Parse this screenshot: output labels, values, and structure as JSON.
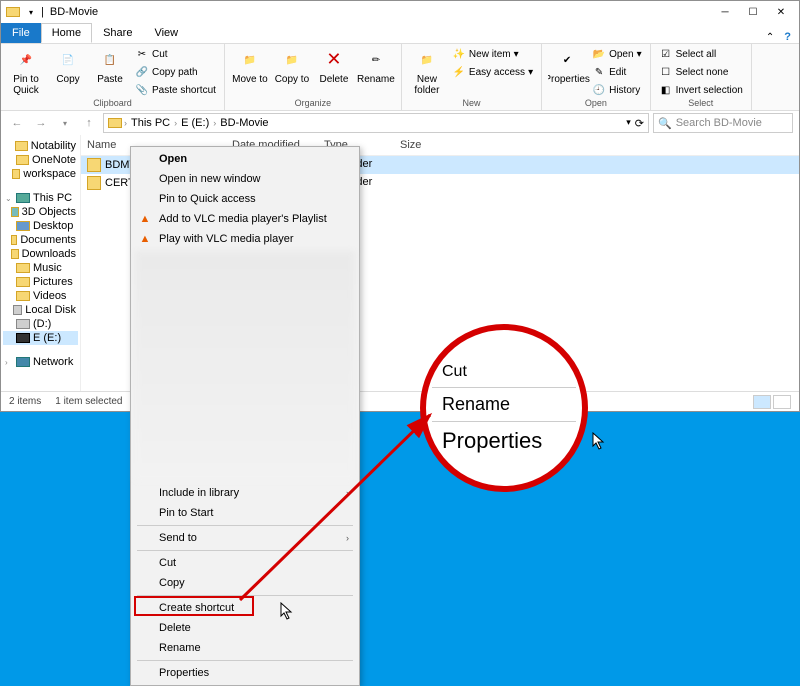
{
  "titlebar": {
    "title": "BD-Movie"
  },
  "tabs": {
    "file": "File",
    "home": "Home",
    "share": "Share",
    "view": "View"
  },
  "ribbon": {
    "clipboard": {
      "pin": "Pin to Quick access",
      "copy": "Copy",
      "paste": "Paste",
      "cut": "Cut",
      "copy_path": "Copy path",
      "paste_shortcut": "Paste shortcut",
      "label": "Clipboard"
    },
    "organize": {
      "move_to": "Move to",
      "copy_to": "Copy to",
      "delete": "Delete",
      "rename": "Rename",
      "label": "Organize"
    },
    "new": {
      "new_folder": "New folder",
      "new_item": "New item",
      "easy_access": "Easy access",
      "label": "New"
    },
    "open": {
      "properties": "Properties",
      "open": "Open",
      "edit": "Edit",
      "history": "History",
      "label": "Open"
    },
    "select": {
      "select_all": "Select all",
      "select_none": "Select none",
      "invert": "Invert selection",
      "label": "Select"
    }
  },
  "breadcrumbs": {
    "root": "This PC",
    "drive": "E (E:)",
    "folder": "BD-Movie"
  },
  "search": {
    "placeholder": "Search BD-Movie"
  },
  "nav": {
    "quick": [
      "Notability",
      "OneNote",
      "workspace"
    ],
    "this_pc": "This PC",
    "pc_items": [
      "3D Objects",
      "Desktop",
      "Documents",
      "Downloads",
      "Music",
      "Pictures",
      "Videos"
    ],
    "drives": [
      "Local Disk",
      "(D:)",
      "E (E:)"
    ],
    "network": "Network"
  },
  "columns": {
    "name": "Name",
    "date": "Date modified",
    "type": "Type",
    "size": "Size"
  },
  "rows": [
    {
      "name": "BDMV",
      "type": "File folder"
    },
    {
      "name": "CERTIFICATE",
      "type": "File folder"
    }
  ],
  "status": {
    "items": "2 items",
    "selected": "1 item selected"
  },
  "context": {
    "open": "Open",
    "open_new": "Open in new window",
    "pin_quick": "Pin to Quick access",
    "vlc_add": "Add to VLC media player's Playlist",
    "vlc_play": "Play with VLC media player",
    "include": "Include in library",
    "pin_start": "Pin to Start",
    "send_to": "Send to",
    "cut": "Cut",
    "copy": "Copy",
    "shortcut": "Create shortcut",
    "delete": "Delete",
    "rename": "Rename",
    "properties": "Properties"
  },
  "callout": {
    "cut": "Cut",
    "rename": "Rename",
    "properties": "Properties"
  }
}
